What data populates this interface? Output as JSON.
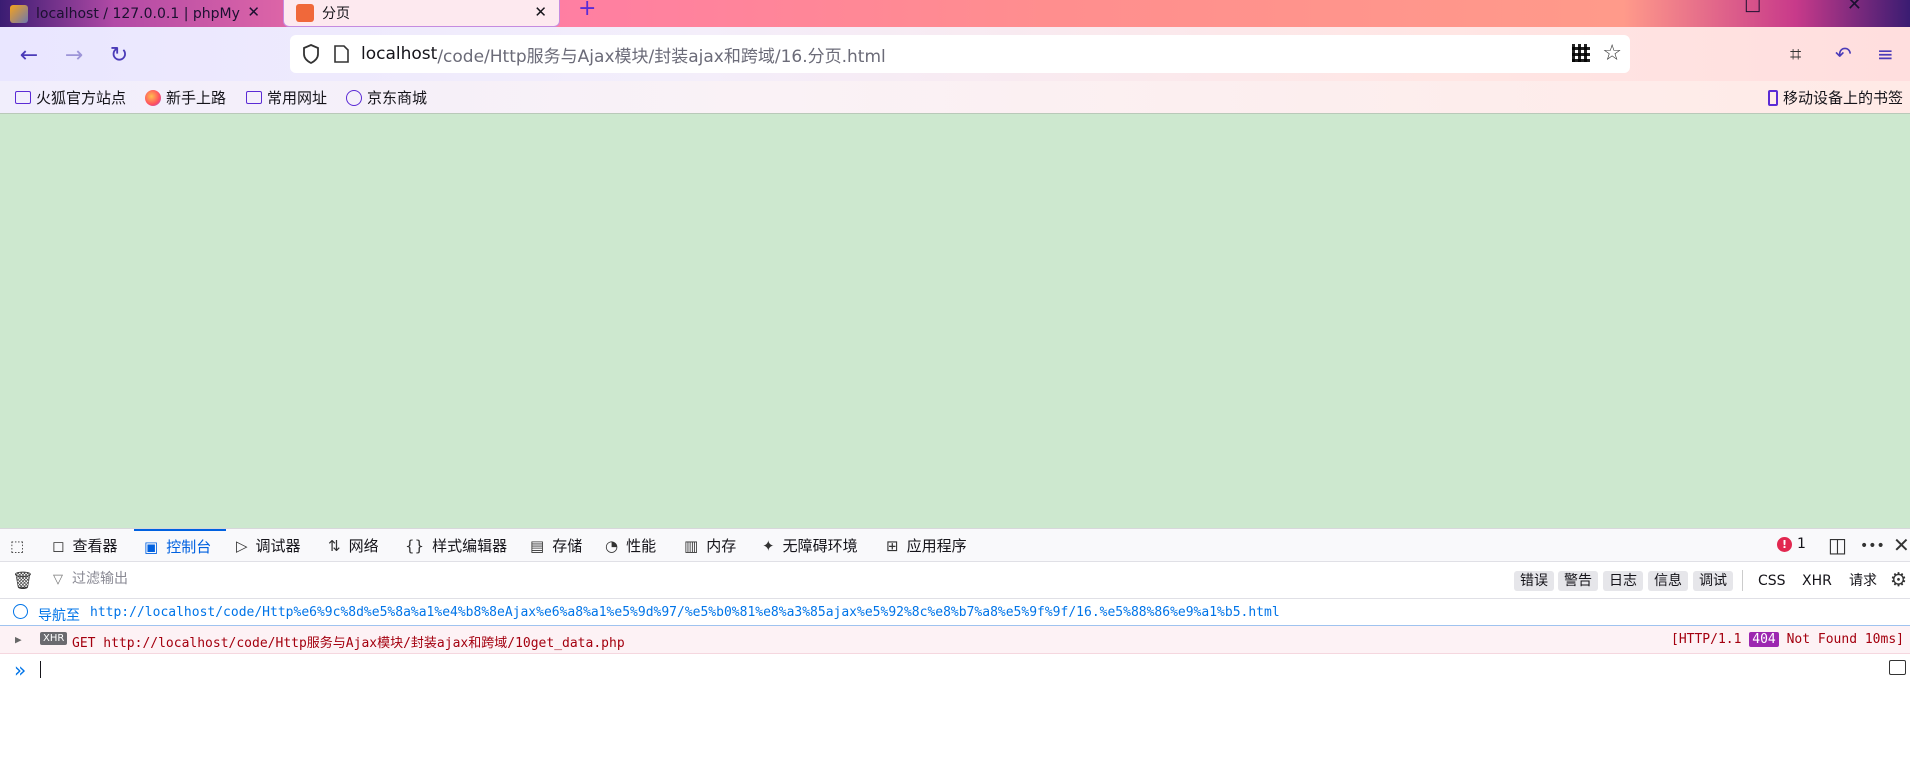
{
  "tabs": [
    {
      "title": "localhost / 127.0.0.1 | phpMy",
      "close": "✕"
    },
    {
      "title": "分页",
      "close": "✕"
    }
  ],
  "new_tab_symbol": "+",
  "window_controls": "□ ✕",
  "nav": {
    "back_icon": "←",
    "forward_icon": "→",
    "reload_icon": "↻",
    "url_host": "localhost",
    "url_path": "/code/Http服务与Ajax模块/封装ajax和跨域/16.分页.html"
  },
  "icons": {
    "shield": "shield-icon",
    "star": "☆",
    "crop": "⌗",
    "undo": "↶",
    "menu": "≡"
  },
  "bookmarks": [
    {
      "label": "火狐官方站点",
      "icon": "folder-icon"
    },
    {
      "label": "新手上路",
      "icon": "firefox-icon"
    },
    {
      "label": "常用网址",
      "icon": "folder-icon"
    },
    {
      "label": "京东商城",
      "icon": "globe-icon"
    }
  ],
  "mobile_bookmarks": "移动设备上的书签",
  "content": {
    "background": "#cde8cf"
  },
  "devtools": {
    "tabs": [
      {
        "label": "查看器",
        "icon": "◻"
      },
      {
        "label": "控制台",
        "icon": "▣",
        "active": true
      },
      {
        "label": "调试器",
        "icon": "▷"
      },
      {
        "label": "网络",
        "icon": "⇅"
      },
      {
        "label": "样式编辑器",
        "icon": "{}"
      },
      {
        "label": "存储",
        "icon": "▤"
      },
      {
        "label": "性能",
        "icon": "◔"
      },
      {
        "label": "内存",
        "icon": "▥"
      },
      {
        "label": "无障碍环境",
        "icon": "✦"
      },
      {
        "label": "应用程序",
        "icon": "⊞"
      }
    ],
    "error_count": "1",
    "error_mark": "!",
    "right_icons": {
      "dock": "◫",
      "more": "•••",
      "close": "✕"
    }
  },
  "filter": {
    "placeholder": "过滤输出",
    "levels": [
      "错误",
      "警告",
      "日志",
      "信息",
      "调试"
    ],
    "requests": [
      "CSS",
      "XHR",
      "请求"
    ]
  },
  "console": {
    "nav_label": "导航至",
    "nav_url": "http://localhost/code/Http%e6%9c%8d%e5%8a%a1%e4%b8%8eAjax%e6%a8%a1%e5%9d%97/%e5%b0%81%e8%a3%85ajax%e5%92%8c%e8%b7%a8%e5%9f%9f/16.%e5%88%86%e9%a1%b5.html",
    "request_tag": "XHR",
    "request_text": "GET http://localhost/code/Http服务与Ajax模块/封装ajax和跨域/10get_data.php",
    "status_prefix": "[HTTP/1.1",
    "status_code": "404",
    "status_suffix": "Not Found 10ms]",
    "prompt": "»"
  },
  "colors": {
    "accent": "#0061e0",
    "error_bg": "#fdf2f5",
    "error_text": "#a4000f",
    "badge_404": "#9c27b0"
  }
}
